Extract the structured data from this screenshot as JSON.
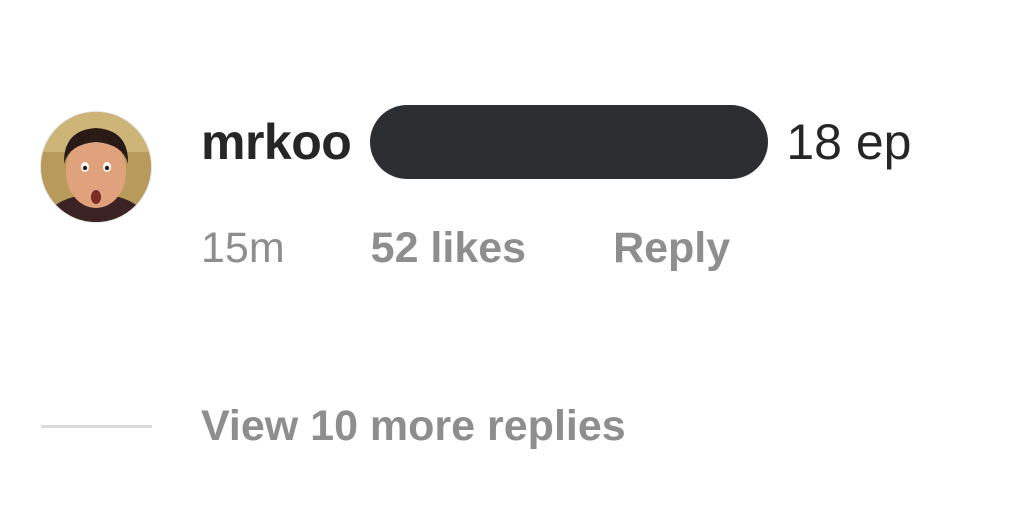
{
  "comment": {
    "avatar_icon": "profile-photo",
    "username": "mrkoo",
    "text_visible": "18 ep",
    "redaction_color": "#2b2f32",
    "timestamp": "15m",
    "likes_label": "52 likes",
    "reply_label": "Reply"
  },
  "replies": {
    "view_more_label": "View 10 more replies"
  },
  "colors": {
    "primary_text": "#262626",
    "secondary_text": "#8e8e8e",
    "divider": "#dbdbdb"
  }
}
